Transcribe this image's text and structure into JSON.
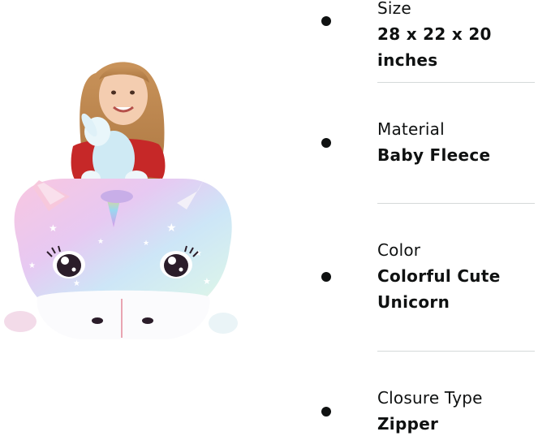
{
  "product_image": {
    "icon": "unicorn-beanbag-with-girl-photo"
  },
  "specs": [
    {
      "label": "Size",
      "value": "28 x 22 x 20 inches"
    },
    {
      "label": "Material",
      "value": "Baby Fleece"
    },
    {
      "label": "Color",
      "value": "Colorful Cute Unicorn"
    },
    {
      "label": "Closure Type",
      "value": "Zipper"
    }
  ],
  "colors": {
    "text": "#0f1111",
    "divider": "#d5d9d9",
    "background": "#ffffff"
  }
}
